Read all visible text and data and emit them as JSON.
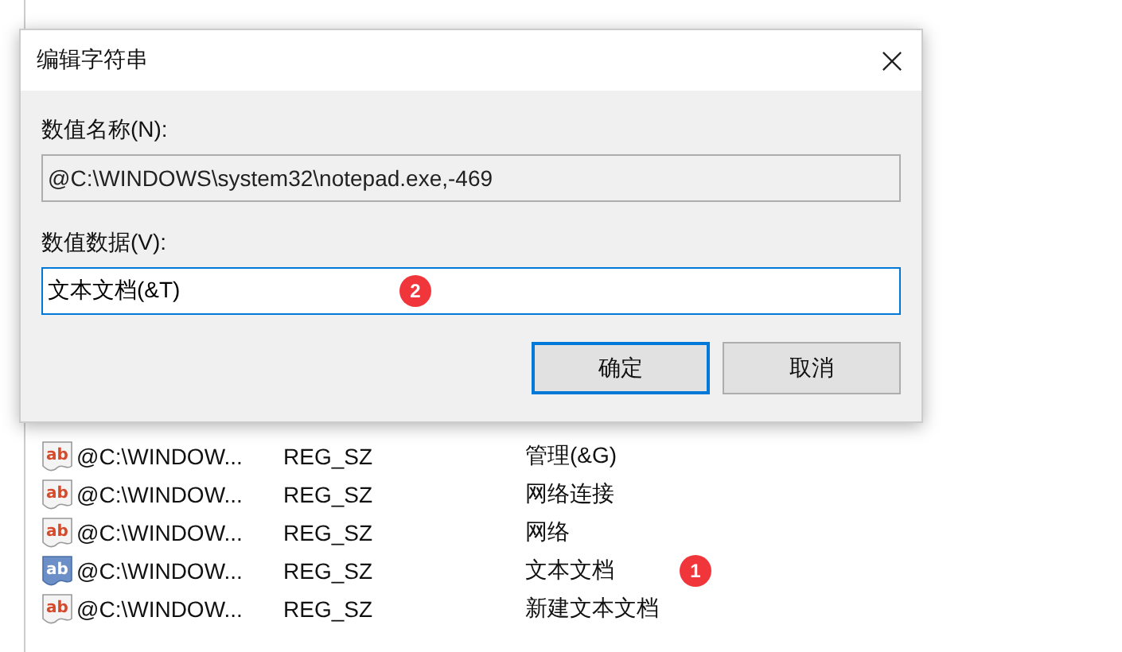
{
  "registry_list": {
    "rows": [
      {
        "icon_text": "ab",
        "name": "@C:\\WINDOW...",
        "type": "REG_SZ",
        "data": "管理(&G)",
        "selected": false
      },
      {
        "icon_text": "ab",
        "name": "@C:\\WINDOW...",
        "type": "REG_SZ",
        "data": "网络连接",
        "selected": false
      },
      {
        "icon_text": "ab",
        "name": "@C:\\WINDOW...",
        "type": "REG_SZ",
        "data": "网络",
        "selected": false
      },
      {
        "icon_text": "ab",
        "name": "@C:\\WINDOW...",
        "type": "REG_SZ",
        "data": "文本文档",
        "selected": true,
        "marker": "1"
      },
      {
        "icon_text": "ab",
        "name": "@C:\\WINDOW...",
        "type": "REG_SZ",
        "data": "新建文本文档",
        "selected": false
      }
    ]
  },
  "dialog": {
    "title": "编辑字符串",
    "name_label": "数值名称(N):",
    "name_value": "@C:\\WINDOWS\\system32\\notepad.exe,-469",
    "data_label": "数值数据(V):",
    "data_value": "文本文档(&T)",
    "data_marker": "2",
    "ok": "确定",
    "cancel": "取消"
  }
}
